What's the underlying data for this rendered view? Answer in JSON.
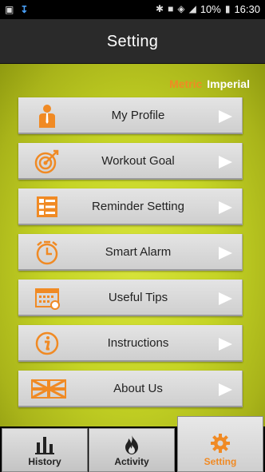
{
  "status_bar": {
    "battery": "10%",
    "time": "16:30"
  },
  "header": {
    "title": "Setting"
  },
  "units": {
    "metric": "Metric",
    "imperial": "Imperial"
  },
  "menu": [
    {
      "label": "My Profile",
      "icon": "profile-icon"
    },
    {
      "label": "Workout Goal",
      "icon": "target-icon"
    },
    {
      "label": "Reminder Setting",
      "icon": "checklist-icon"
    },
    {
      "label": "Smart Alarm",
      "icon": "alarm-clock-icon"
    },
    {
      "label": "Useful Tips",
      "icon": "calendar-icon"
    },
    {
      "label": "Instructions",
      "icon": "info-icon"
    },
    {
      "label": "About Us",
      "icon": "uk-flag-icon"
    }
  ],
  "tabs": [
    {
      "label": "History",
      "icon": "bar-chart-icon"
    },
    {
      "label": "Activity",
      "icon": "flame-icon"
    },
    {
      "label": "Setting",
      "icon": "gear-icon",
      "active": true
    }
  ],
  "colors": {
    "accent": "#f08a24",
    "background": "#c5d425",
    "header": "#2a2a2a"
  }
}
